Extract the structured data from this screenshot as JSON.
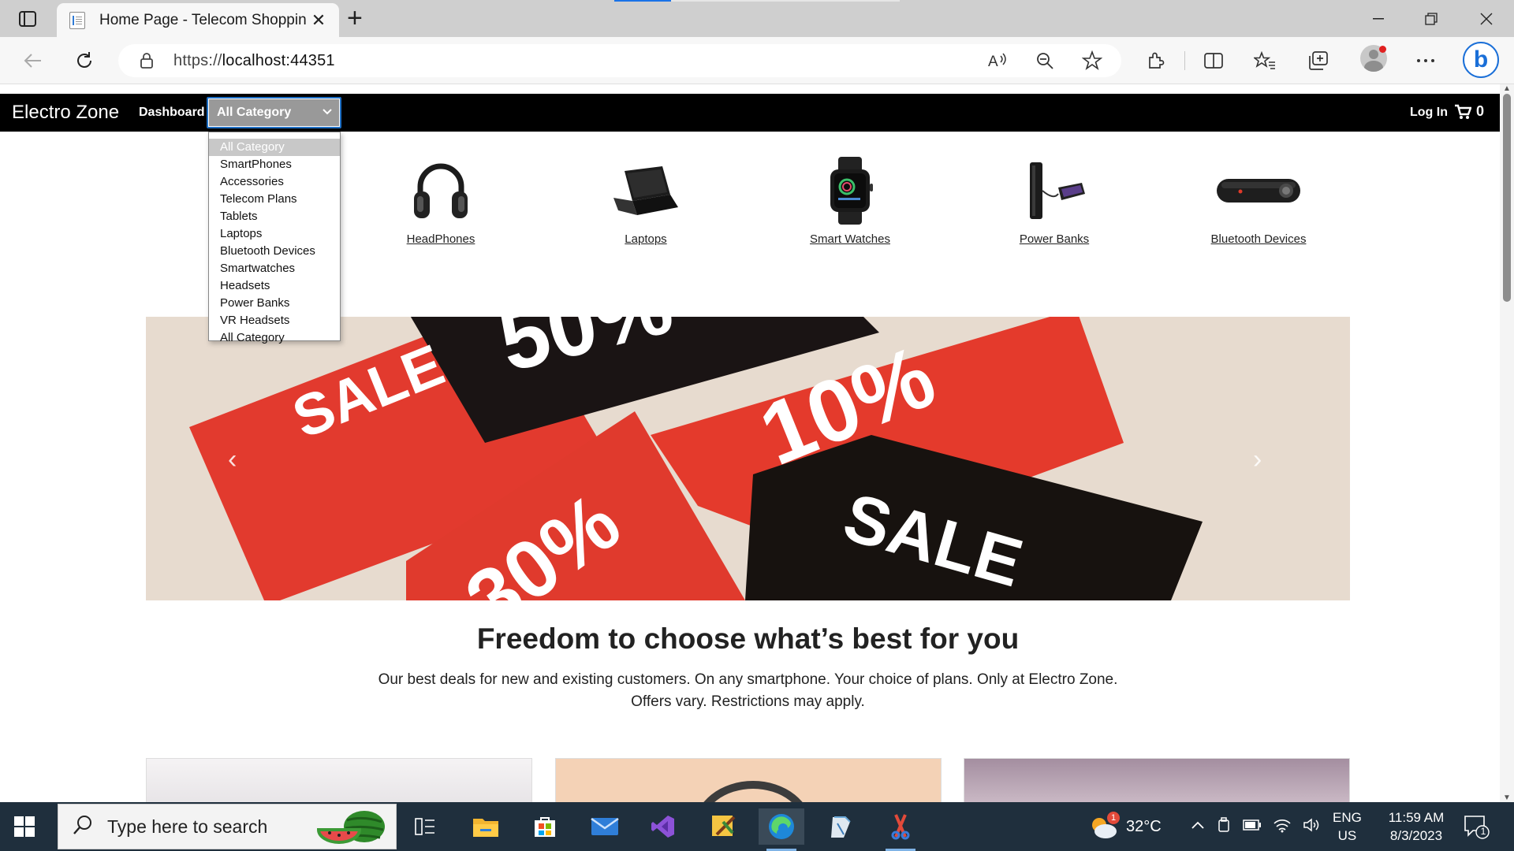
{
  "browser": {
    "tab_title": "Home Page - Telecom Shopping",
    "url_scheme": "https://",
    "url_host": "localhost:44351"
  },
  "site": {
    "brand": "Electro Zone",
    "nav_dashboard": "Dashboard",
    "category_select": "All Category",
    "login": "Log In",
    "cart_count": "0"
  },
  "dropdown": {
    "options": [
      "All Category",
      "SmartPhones",
      "Accessories",
      "Telecom Plans",
      "Tablets",
      "Laptops",
      "Bluetooth Devices",
      "Smartwatches",
      "Headsets",
      "Power Banks",
      "VR Headsets",
      "All Category"
    ]
  },
  "categories": [
    {
      "label": "HeadPhones",
      "icon": "headphones-icon"
    },
    {
      "label": "Laptops",
      "icon": "laptop-icon"
    },
    {
      "label": "Smart Watches",
      "icon": "smartwatch-icon"
    },
    {
      "label": "Power Banks",
      "icon": "power-bank-icon"
    },
    {
      "label": "Bluetooth Devices",
      "icon": "bluetooth-speaker-icon"
    }
  ],
  "hero": {
    "tag_texts": [
      "SALE",
      "50%",
      "10%",
      "30%",
      "SALE"
    ]
  },
  "promo": {
    "headline": "Freedom to choose what’s best for you",
    "line1": "Our best deals for new and existing customers. On any smartphone. Your choice of plans. Only at Electro Zone.",
    "line2": "Offers vary. Restrictions may apply."
  },
  "taskbar": {
    "search_placeholder": "Type here to search",
    "weather_temp": "32°C",
    "weather_badge": "1",
    "lang_top": "ENG",
    "lang_bottom": "US",
    "time": "11:59 AM",
    "date": "8/3/2023",
    "notification_count": "1"
  },
  "colors": {
    "navbar": "#000000",
    "select_bg": "#999999",
    "select_border": "#1c6ec4",
    "sale_red": "#e8372b",
    "taskbar": "#1f2f3d"
  }
}
